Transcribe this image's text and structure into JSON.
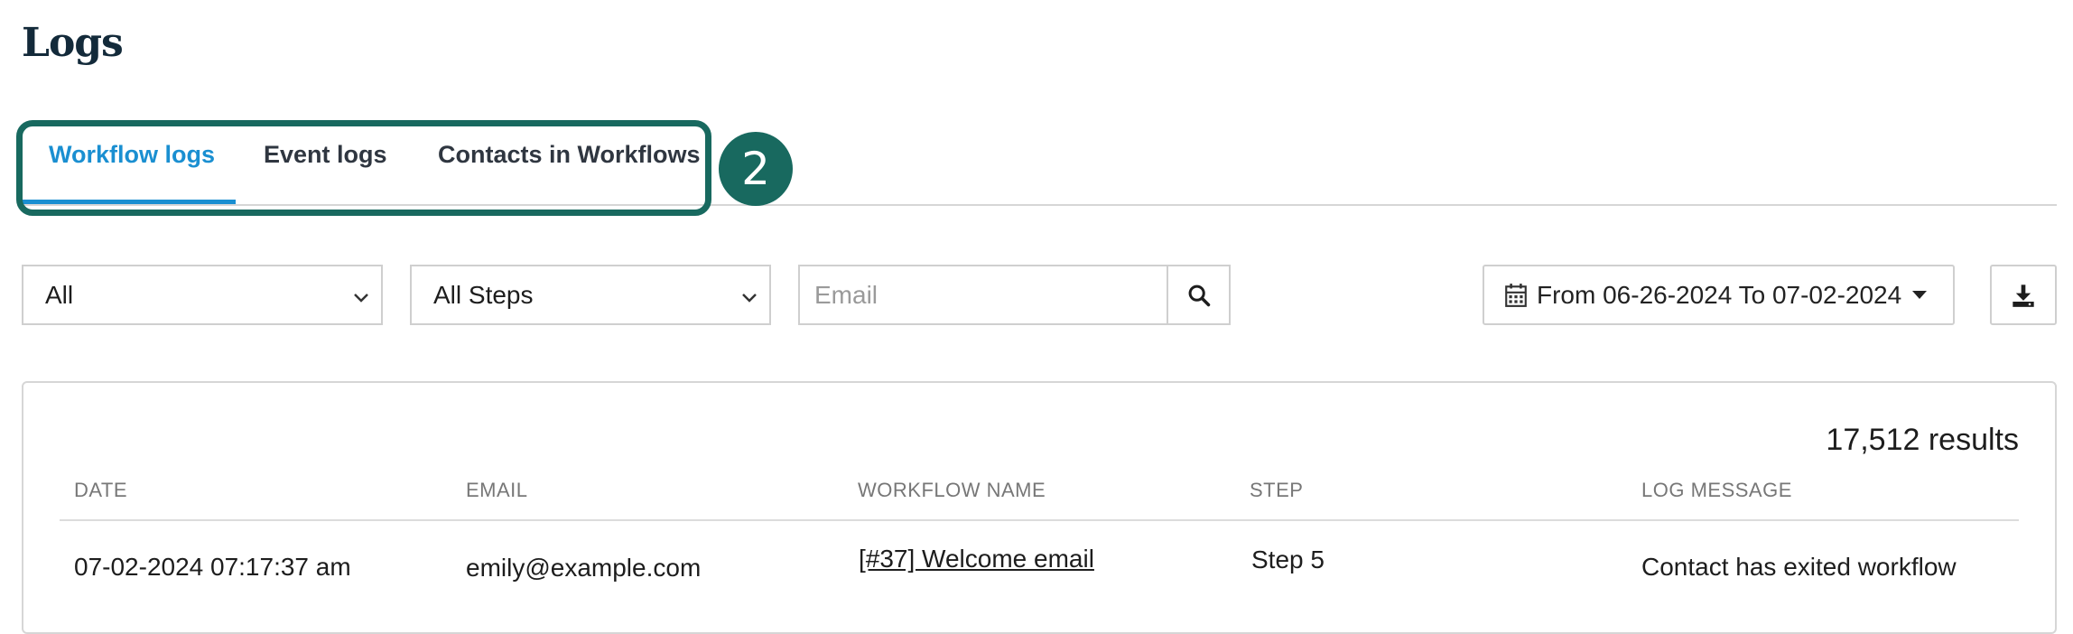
{
  "page": {
    "title": "Logs"
  },
  "tabs": [
    {
      "label": "Workflow logs",
      "active": true
    },
    {
      "label": "Event logs",
      "active": false
    },
    {
      "label": "Contacts in Workflows",
      "active": false
    }
  ],
  "annotation": {
    "badge": "2"
  },
  "filters": {
    "status_select": "All",
    "steps_select": "All Steps",
    "email_placeholder": "Email",
    "date_range": "From 06-26-2024 To 07-02-2024"
  },
  "icons": {
    "search": "search-icon",
    "calendar": "calendar-icon",
    "download": "download-icon",
    "chevron": "chevron-down-icon"
  },
  "colors": {
    "accent": "#1a8fd1",
    "highlight": "#18695f",
    "title": "#132a3a"
  },
  "table": {
    "results_count": "17,512 results",
    "columns": [
      "DATE",
      "EMAIL",
      "WORKFLOW NAME",
      "STEP",
      "LOG MESSAGE"
    ],
    "rows": [
      {
        "date": "07-02-2024 07:17:37 am",
        "email": "emily@example.com",
        "workflow": "[#37] Welcome email",
        "step": "Step 5",
        "message": "Contact has exited workflow"
      }
    ]
  }
}
